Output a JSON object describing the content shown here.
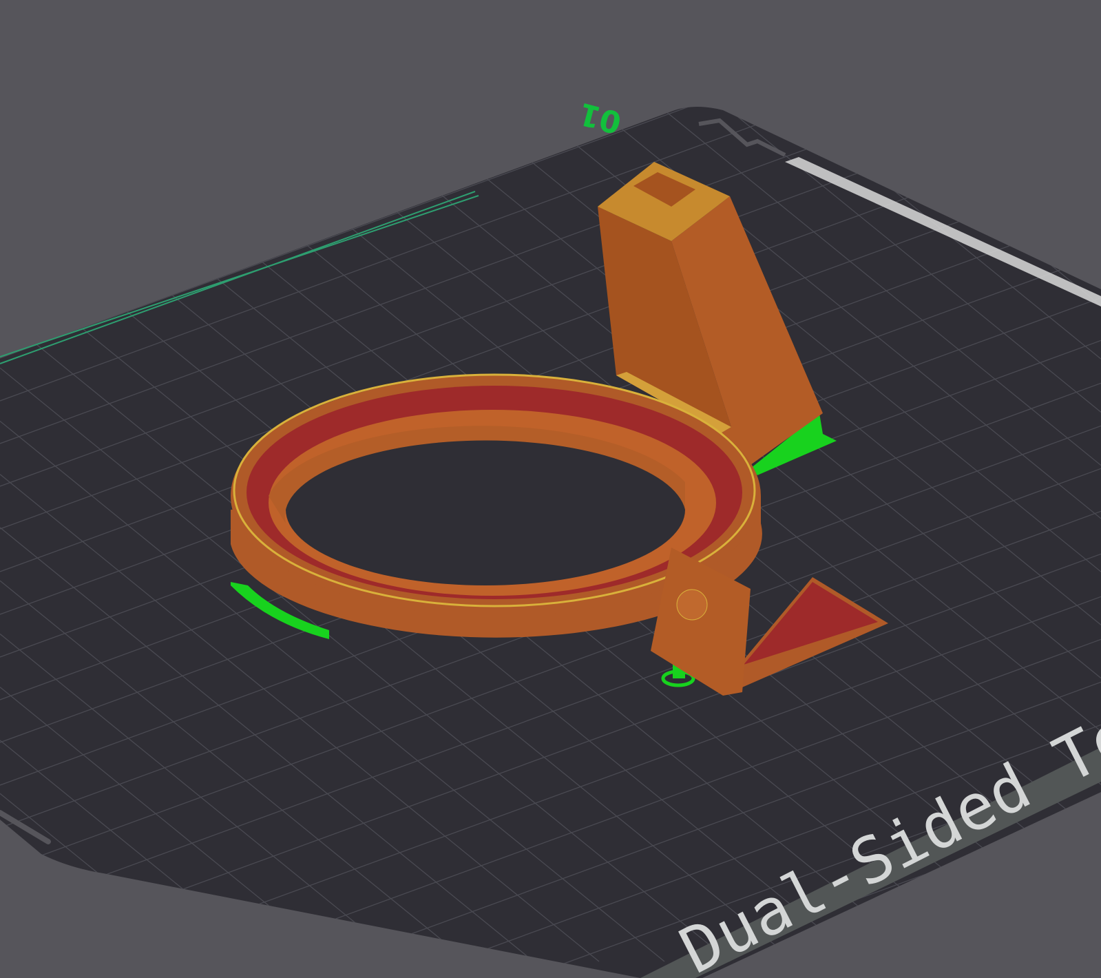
{
  "viewport": {
    "plate_number": "01",
    "plate_text": "Dual-Sided Text",
    "colors": {
      "background": "#56555b",
      "bed": "#2f2e35",
      "grid": "#4a4a52",
      "model": "#b05a28",
      "infill": "#9e2a2a",
      "support": "#18d21e",
      "plate_label": "#12c03c"
    }
  }
}
